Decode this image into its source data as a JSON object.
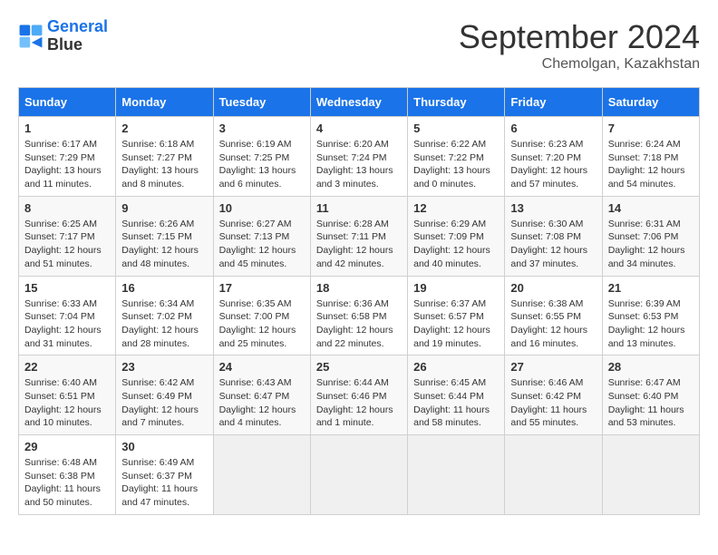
{
  "header": {
    "logo_line1": "General",
    "logo_line2": "Blue",
    "month": "September 2024",
    "location": "Chemolgan, Kazakhstan"
  },
  "days_of_week": [
    "Sunday",
    "Monday",
    "Tuesday",
    "Wednesday",
    "Thursday",
    "Friday",
    "Saturday"
  ],
  "weeks": [
    [
      {
        "day": "1",
        "lines": [
          "Sunrise: 6:17 AM",
          "Sunset: 7:29 PM",
          "Daylight: 13 hours",
          "and 11 minutes."
        ]
      },
      {
        "day": "2",
        "lines": [
          "Sunrise: 6:18 AM",
          "Sunset: 7:27 PM",
          "Daylight: 13 hours",
          "and 8 minutes."
        ]
      },
      {
        "day": "3",
        "lines": [
          "Sunrise: 6:19 AM",
          "Sunset: 7:25 PM",
          "Daylight: 13 hours",
          "and 6 minutes."
        ]
      },
      {
        "day": "4",
        "lines": [
          "Sunrise: 6:20 AM",
          "Sunset: 7:24 PM",
          "Daylight: 13 hours",
          "and 3 minutes."
        ]
      },
      {
        "day": "5",
        "lines": [
          "Sunrise: 6:22 AM",
          "Sunset: 7:22 PM",
          "Daylight: 13 hours",
          "and 0 minutes."
        ]
      },
      {
        "day": "6",
        "lines": [
          "Sunrise: 6:23 AM",
          "Sunset: 7:20 PM",
          "Daylight: 12 hours",
          "and 57 minutes."
        ]
      },
      {
        "day": "7",
        "lines": [
          "Sunrise: 6:24 AM",
          "Sunset: 7:18 PM",
          "Daylight: 12 hours",
          "and 54 minutes."
        ]
      }
    ],
    [
      {
        "day": "8",
        "lines": [
          "Sunrise: 6:25 AM",
          "Sunset: 7:17 PM",
          "Daylight: 12 hours",
          "and 51 minutes."
        ]
      },
      {
        "day": "9",
        "lines": [
          "Sunrise: 6:26 AM",
          "Sunset: 7:15 PM",
          "Daylight: 12 hours",
          "and 48 minutes."
        ]
      },
      {
        "day": "10",
        "lines": [
          "Sunrise: 6:27 AM",
          "Sunset: 7:13 PM",
          "Daylight: 12 hours",
          "and 45 minutes."
        ]
      },
      {
        "day": "11",
        "lines": [
          "Sunrise: 6:28 AM",
          "Sunset: 7:11 PM",
          "Daylight: 12 hours",
          "and 42 minutes."
        ]
      },
      {
        "day": "12",
        "lines": [
          "Sunrise: 6:29 AM",
          "Sunset: 7:09 PM",
          "Daylight: 12 hours",
          "and 40 minutes."
        ]
      },
      {
        "day": "13",
        "lines": [
          "Sunrise: 6:30 AM",
          "Sunset: 7:08 PM",
          "Daylight: 12 hours",
          "and 37 minutes."
        ]
      },
      {
        "day": "14",
        "lines": [
          "Sunrise: 6:31 AM",
          "Sunset: 7:06 PM",
          "Daylight: 12 hours",
          "and 34 minutes."
        ]
      }
    ],
    [
      {
        "day": "15",
        "lines": [
          "Sunrise: 6:33 AM",
          "Sunset: 7:04 PM",
          "Daylight: 12 hours",
          "and 31 minutes."
        ]
      },
      {
        "day": "16",
        "lines": [
          "Sunrise: 6:34 AM",
          "Sunset: 7:02 PM",
          "Daylight: 12 hours",
          "and 28 minutes."
        ]
      },
      {
        "day": "17",
        "lines": [
          "Sunrise: 6:35 AM",
          "Sunset: 7:00 PM",
          "Daylight: 12 hours",
          "and 25 minutes."
        ]
      },
      {
        "day": "18",
        "lines": [
          "Sunrise: 6:36 AM",
          "Sunset: 6:58 PM",
          "Daylight: 12 hours",
          "and 22 minutes."
        ]
      },
      {
        "day": "19",
        "lines": [
          "Sunrise: 6:37 AM",
          "Sunset: 6:57 PM",
          "Daylight: 12 hours",
          "and 19 minutes."
        ]
      },
      {
        "day": "20",
        "lines": [
          "Sunrise: 6:38 AM",
          "Sunset: 6:55 PM",
          "Daylight: 12 hours",
          "and 16 minutes."
        ]
      },
      {
        "day": "21",
        "lines": [
          "Sunrise: 6:39 AM",
          "Sunset: 6:53 PM",
          "Daylight: 12 hours",
          "and 13 minutes."
        ]
      }
    ],
    [
      {
        "day": "22",
        "lines": [
          "Sunrise: 6:40 AM",
          "Sunset: 6:51 PM",
          "Daylight: 12 hours",
          "and 10 minutes."
        ]
      },
      {
        "day": "23",
        "lines": [
          "Sunrise: 6:42 AM",
          "Sunset: 6:49 PM",
          "Daylight: 12 hours",
          "and 7 minutes."
        ]
      },
      {
        "day": "24",
        "lines": [
          "Sunrise: 6:43 AM",
          "Sunset: 6:47 PM",
          "Daylight: 12 hours",
          "and 4 minutes."
        ]
      },
      {
        "day": "25",
        "lines": [
          "Sunrise: 6:44 AM",
          "Sunset: 6:46 PM",
          "Daylight: 12 hours",
          "and 1 minute."
        ]
      },
      {
        "day": "26",
        "lines": [
          "Sunrise: 6:45 AM",
          "Sunset: 6:44 PM",
          "Daylight: 11 hours",
          "and 58 minutes."
        ]
      },
      {
        "day": "27",
        "lines": [
          "Sunrise: 6:46 AM",
          "Sunset: 6:42 PM",
          "Daylight: 11 hours",
          "and 55 minutes."
        ]
      },
      {
        "day": "28",
        "lines": [
          "Sunrise: 6:47 AM",
          "Sunset: 6:40 PM",
          "Daylight: 11 hours",
          "and 53 minutes."
        ]
      }
    ],
    [
      {
        "day": "29",
        "lines": [
          "Sunrise: 6:48 AM",
          "Sunset: 6:38 PM",
          "Daylight: 11 hours",
          "and 50 minutes."
        ]
      },
      {
        "day": "30",
        "lines": [
          "Sunrise: 6:49 AM",
          "Sunset: 6:37 PM",
          "Daylight: 11 hours",
          "and 47 minutes."
        ]
      },
      {
        "day": "",
        "lines": []
      },
      {
        "day": "",
        "lines": []
      },
      {
        "day": "",
        "lines": []
      },
      {
        "day": "",
        "lines": []
      },
      {
        "day": "",
        "lines": []
      }
    ]
  ]
}
